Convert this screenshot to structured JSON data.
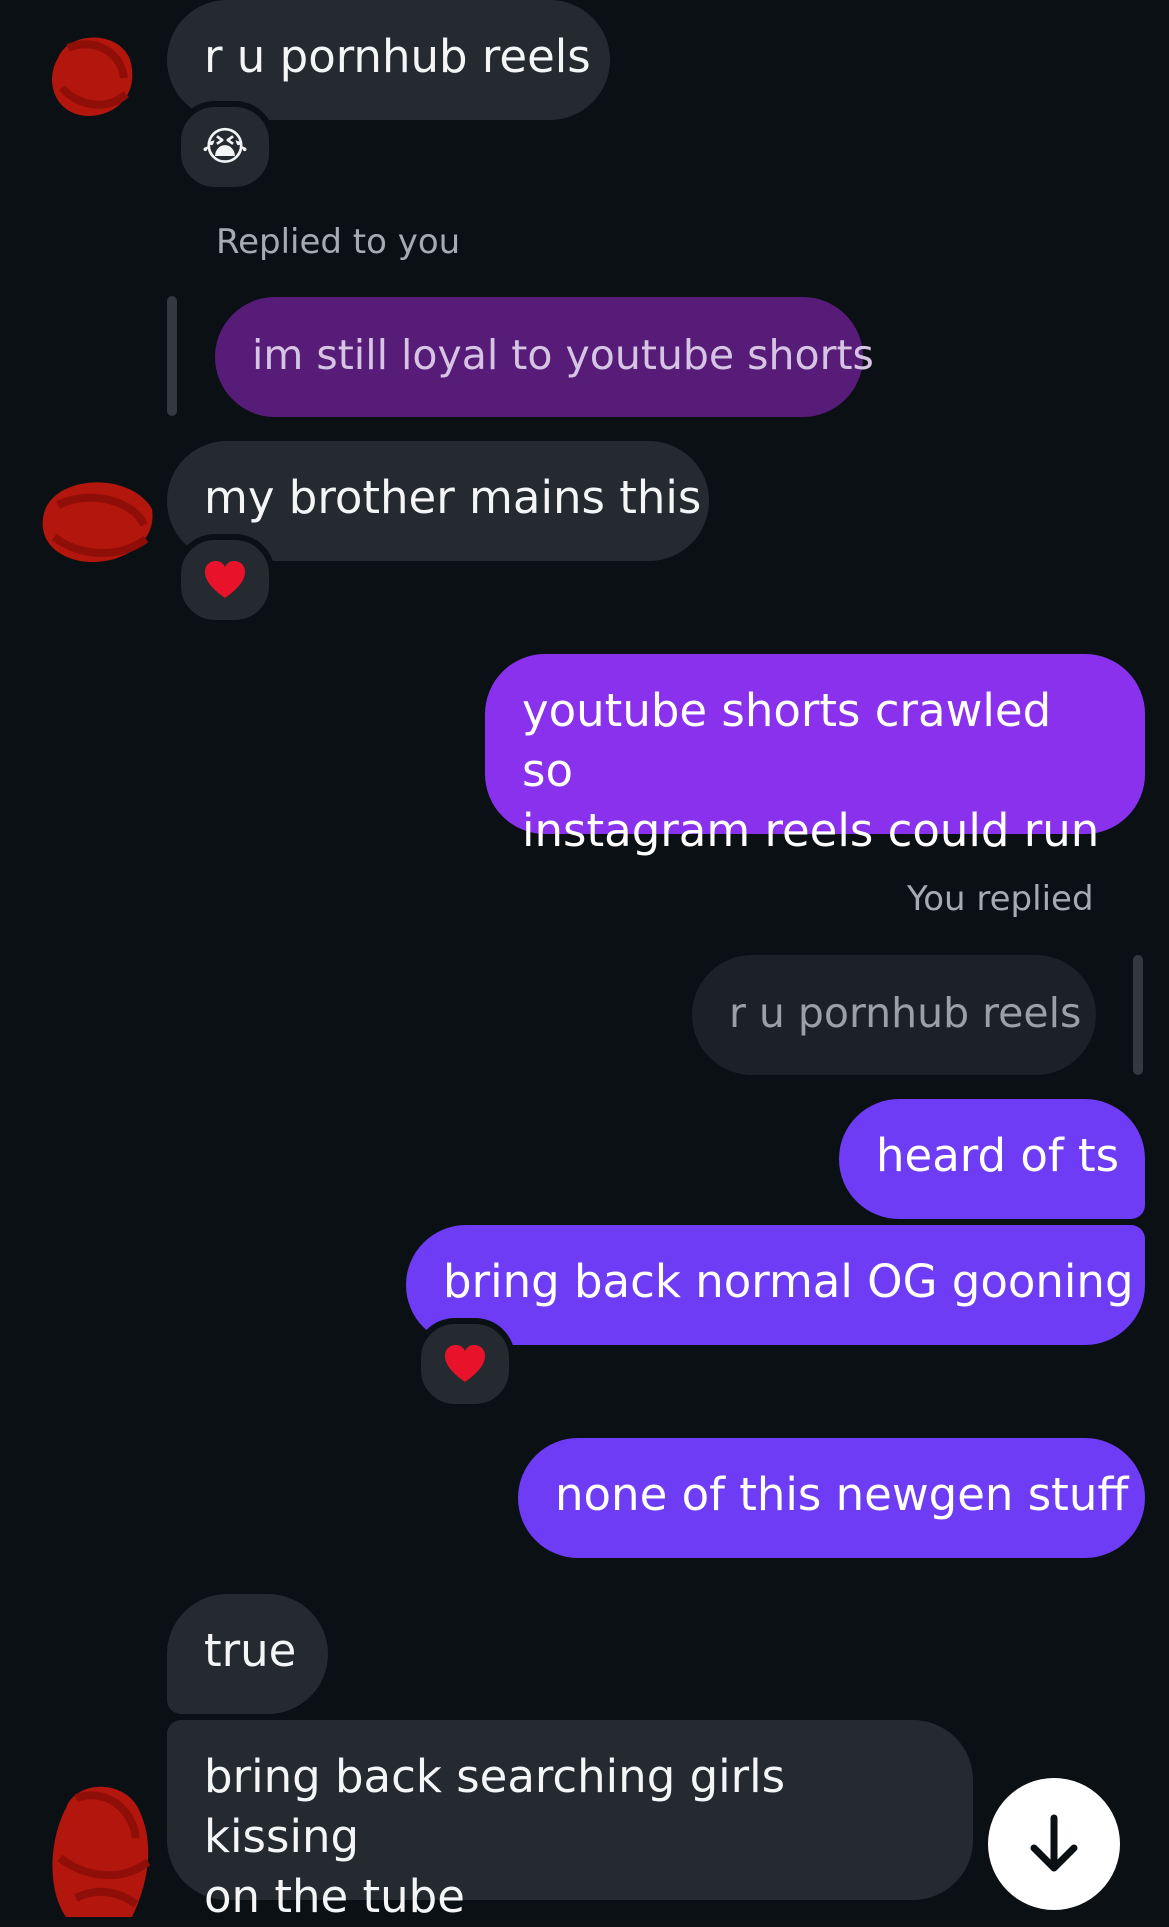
{
  "messages": {
    "m1": {
      "text": "r u pornhub reels"
    },
    "m1_reaction": "😭",
    "reply_label_1": "Replied to you",
    "quoted_1": "im still loyal to youtube shorts",
    "m2": {
      "text": "my brother mains this"
    },
    "m3_line1": "youtube shorts crawled so",
    "m3_line2": "instagram reels could run",
    "reply_label_2": "You replied",
    "quoted_2": "r u pornhub reels",
    "m4": "heard of ts",
    "m5": "bring back normal OG gooning",
    "m6": "none of this newgen stuff",
    "m7": "true",
    "m8_line1": "bring back searching girls kissing",
    "m8_line2": "on the tube"
  },
  "icons": {
    "reaction_heart": "heart-icon",
    "reaction_crying": "loudly-crying-face-icon",
    "scroll": "arrow-down-icon"
  },
  "colors": {
    "background": "#0b1014",
    "incoming_bubble": "#252a31",
    "outgoing_purple": "#8a31ee",
    "outgoing_violet": "#6d3cf4",
    "quoted_purple": "#571b78",
    "redaction": "#b3160c"
  }
}
